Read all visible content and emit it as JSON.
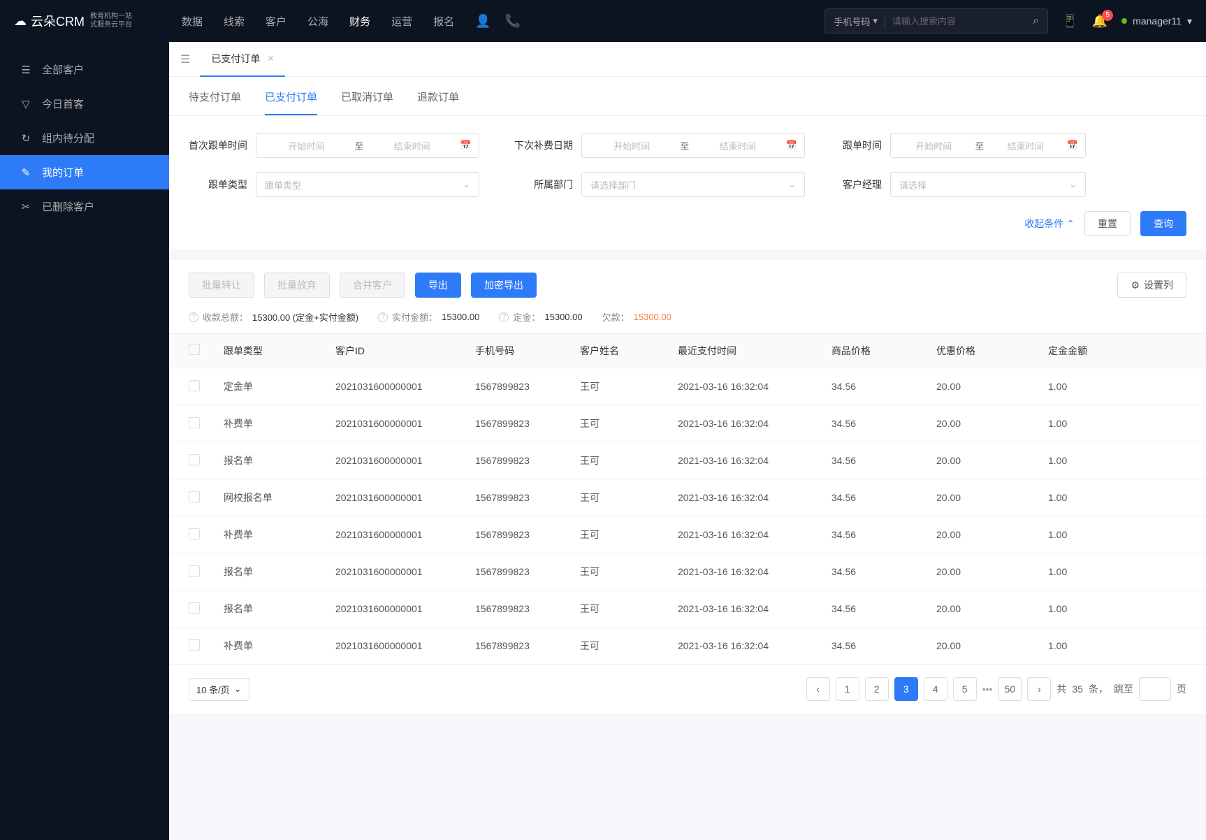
{
  "header": {
    "logo": "云朵CRM",
    "logo_sub1": "教育机构一站",
    "logo_sub2": "式服务云平台",
    "nav": [
      "数据",
      "线索",
      "客户",
      "公海",
      "财务",
      "运营",
      "报名"
    ],
    "nav_active_index": 4,
    "search_type": "手机号码",
    "search_placeholder": "请输入搜索内容",
    "notif_count": "5",
    "user_name": "manager11"
  },
  "sidebar": {
    "items": [
      {
        "label": "全部客户",
        "icon": "☰"
      },
      {
        "label": "今日首客",
        "icon": "▽"
      },
      {
        "label": "组内待分配",
        "icon": "↻"
      },
      {
        "label": "我的订单",
        "icon": "✎"
      },
      {
        "label": "已删除客户",
        "icon": "✂"
      }
    ],
    "active_index": 3
  },
  "tabs": {
    "items": [
      "已支付订单"
    ],
    "active_index": 0
  },
  "sub_tabs": {
    "items": [
      "待支付订单",
      "已支付订单",
      "已取消订单",
      "退款订单"
    ],
    "active_index": 1
  },
  "filters": {
    "first_follow": "首次跟单时间",
    "next_fee_date": "下次补费日期",
    "follow_time": "跟单时间",
    "follow_type": "跟单类型",
    "department": "所属部门",
    "manager": "客户经理",
    "start_ph": "开始时间",
    "end_ph": "结束时间",
    "to": "至",
    "type_ph": "跟单类型",
    "dept_ph": "请选择部门",
    "mgr_ph": "请选择",
    "collapse": "收起条件",
    "reset": "重置",
    "query": "查询"
  },
  "actions": {
    "batch_transfer": "批量转让",
    "batch_abandon": "批量放弃",
    "merge": "合并客户",
    "export": "导出",
    "enc_export": "加密导出",
    "set_cols": "设置列"
  },
  "summary": {
    "total_label": "收款总额：",
    "total_value": "15300.00 (定金+实付金额)",
    "paid_label": "实付金额：",
    "paid_value": "15300.00",
    "deposit_label": "定金：",
    "deposit_value": "15300.00",
    "debt_label": "欠款：",
    "debt_value": "15300.00"
  },
  "table": {
    "headers": [
      "跟单类型",
      "客户ID",
      "手机号码",
      "客户姓名",
      "最近支付时间",
      "商品价格",
      "优惠价格",
      "定金金额"
    ],
    "rows": [
      {
        "type": "定金单",
        "id": "2021031600000001",
        "phone": "1567899823",
        "name": "王可",
        "time": "2021-03-16 16:32:04",
        "price": "34.56",
        "discount": "20.00",
        "deposit": "1.00"
      },
      {
        "type": "补费单",
        "id": "2021031600000001",
        "phone": "1567899823",
        "name": "王可",
        "time": "2021-03-16 16:32:04",
        "price": "34.56",
        "discount": "20.00",
        "deposit": "1.00"
      },
      {
        "type": "报名单",
        "id": "2021031600000001",
        "phone": "1567899823",
        "name": "王可",
        "time": "2021-03-16 16:32:04",
        "price": "34.56",
        "discount": "20.00",
        "deposit": "1.00"
      },
      {
        "type": "网校报名单",
        "id": "2021031600000001",
        "phone": "1567899823",
        "name": "王可",
        "time": "2021-03-16 16:32:04",
        "price": "34.56",
        "discount": "20.00",
        "deposit": "1.00"
      },
      {
        "type": "补费单",
        "id": "2021031600000001",
        "phone": "1567899823",
        "name": "王可",
        "time": "2021-03-16 16:32:04",
        "price": "34.56",
        "discount": "20.00",
        "deposit": "1.00"
      },
      {
        "type": "报名单",
        "id": "2021031600000001",
        "phone": "1567899823",
        "name": "王可",
        "time": "2021-03-16 16:32:04",
        "price": "34.56",
        "discount": "20.00",
        "deposit": "1.00"
      },
      {
        "type": "报名单",
        "id": "2021031600000001",
        "phone": "1567899823",
        "name": "王可",
        "time": "2021-03-16 16:32:04",
        "price": "34.56",
        "discount": "20.00",
        "deposit": "1.00"
      },
      {
        "type": "补费单",
        "id": "2021031600000001",
        "phone": "1567899823",
        "name": "王可",
        "time": "2021-03-16 16:32:04",
        "price": "34.56",
        "discount": "20.00",
        "deposit": "1.00"
      }
    ]
  },
  "pagination": {
    "page_size": "10 条/页",
    "pages": [
      "1",
      "2",
      "3",
      "4",
      "5"
    ],
    "active_page": "3",
    "last_page": "50",
    "total_prefix": "共 ",
    "total": "35",
    "total_suffix": " 条，",
    "jump_label": "跳至",
    "page_suffix": "页"
  }
}
